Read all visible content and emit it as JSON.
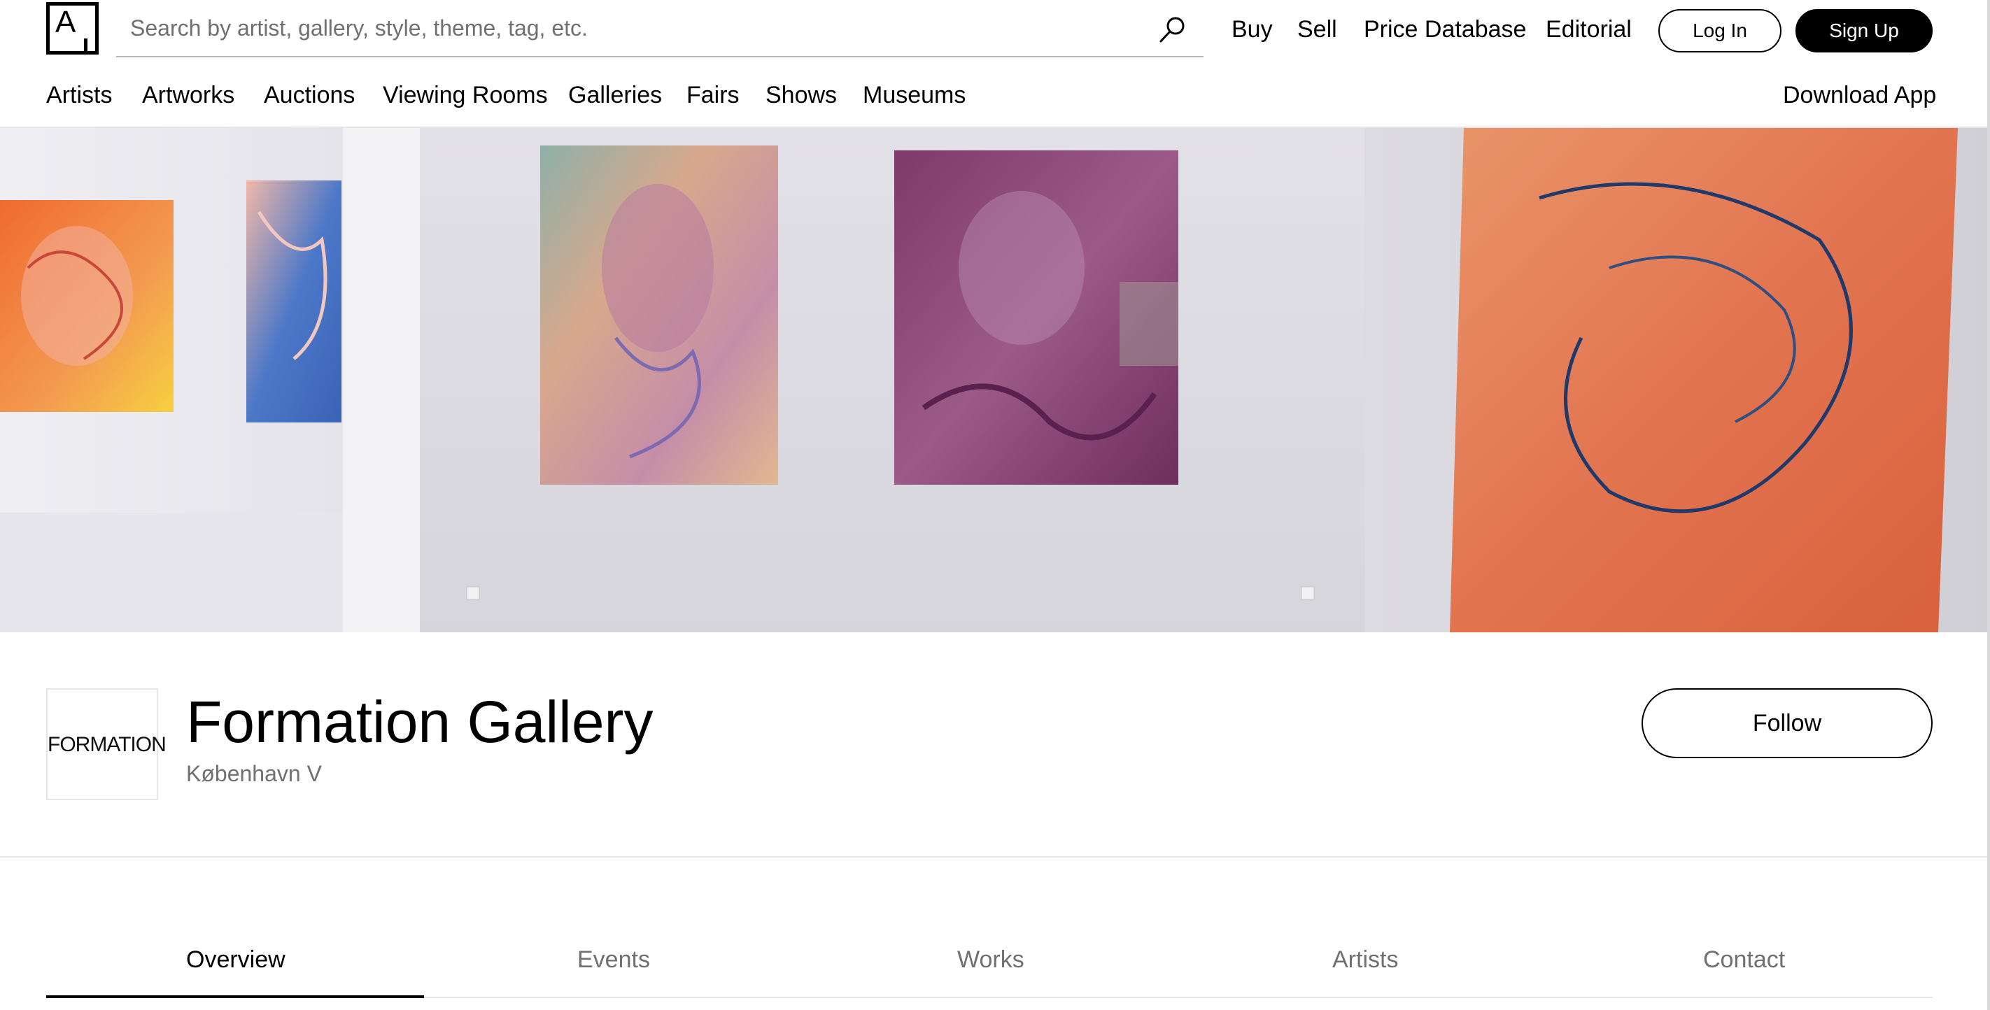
{
  "header": {
    "logo_letter": "A",
    "search": {
      "placeholder": "Search by artist, gallery, style, theme, tag, etc.",
      "value": ""
    },
    "nav_links": [
      "Buy",
      "Sell",
      "Price Database",
      "Editorial"
    ],
    "login_label": "Log In",
    "signup_label": "Sign Up"
  },
  "main_nav": {
    "items": [
      "Artists",
      "Artworks",
      "Auctions",
      "Viewing Rooms",
      "Galleries",
      "Fairs",
      "Shows",
      "Museums"
    ],
    "download_app": "Download App"
  },
  "hero": {
    "icon": "installation-photo"
  },
  "profile": {
    "logo_text": "FORMATION",
    "name": "Formation Gallery",
    "location": "København V",
    "follow_label": "Follow"
  },
  "tabs": {
    "items": [
      "Overview",
      "Events",
      "Works",
      "Artists",
      "Contact"
    ],
    "active": "Overview"
  },
  "colors": {
    "text": "#000000",
    "muted": "#707070",
    "divider": "#e6e6e6",
    "button_dark": "#000000"
  }
}
